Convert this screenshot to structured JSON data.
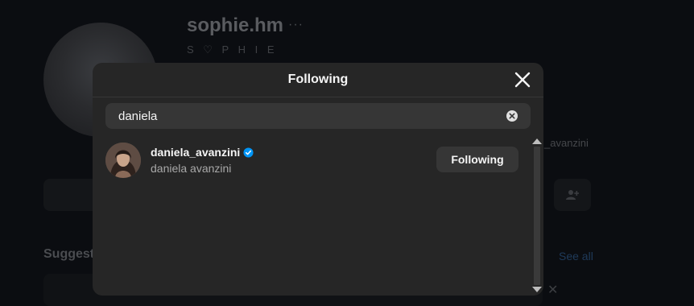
{
  "background": {
    "profile_username": "sophie.hm",
    "more_glyph": "···",
    "profile_fullname": "S ♡ P H I E",
    "mention_text": "_avanzini",
    "suggested_label": "Suggested",
    "see_all_label": "See all",
    "dismiss_glyph": "✕"
  },
  "modal": {
    "title": "Following",
    "close_icon": "close-icon",
    "search": {
      "value": "daniela",
      "placeholder": "Search",
      "clear_icon": "clear-icon"
    },
    "results": [
      {
        "username": "daniela_avanzini",
        "verified": true,
        "full_name": "daniela avanzini",
        "button_label": "Following"
      }
    ]
  },
  "colors": {
    "modal_bg": "#262626",
    "button_bg": "#363636",
    "verified_blue": "#0095f6",
    "page_bg": "#0b0d11"
  }
}
